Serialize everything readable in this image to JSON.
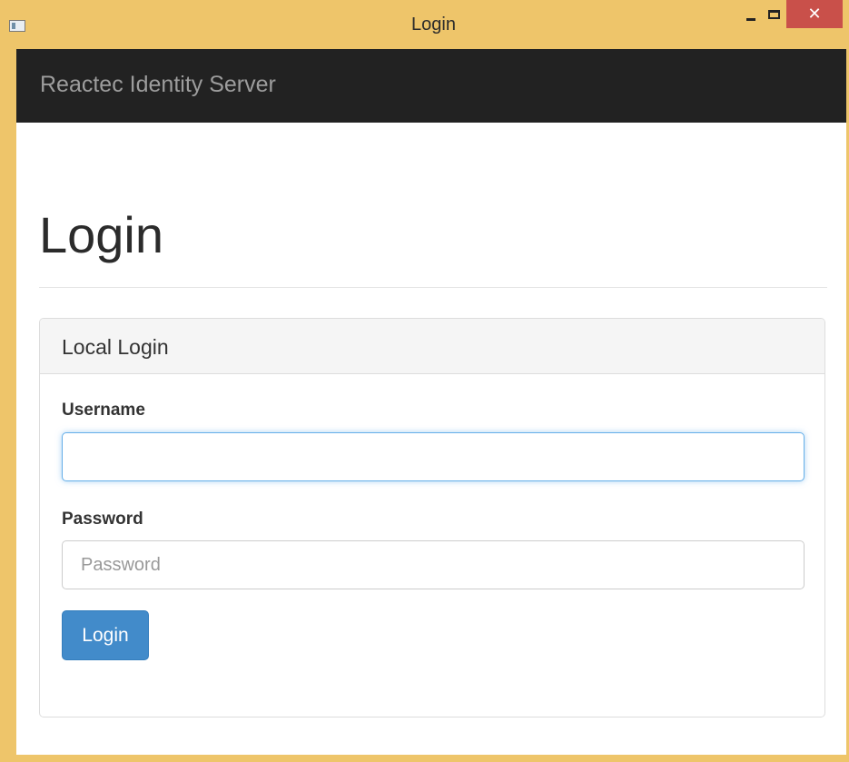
{
  "window": {
    "title": "Login",
    "controls": {
      "minimize_icon": "minimize-icon",
      "maximize_icon": "maximize-icon",
      "close_label": "✕"
    },
    "accent_color": "#eec56a",
    "close_color": "#c9504a"
  },
  "navbar": {
    "brand": "Reactec Identity Server",
    "background_color": "#222222"
  },
  "page": {
    "title": "Login"
  },
  "login_panel": {
    "heading": "Local Login",
    "username": {
      "label": "Username",
      "value": "",
      "placeholder": ""
    },
    "password": {
      "label": "Password",
      "value": "",
      "placeholder": "Password"
    },
    "submit_label": "Login",
    "button_color": "#428bca"
  }
}
